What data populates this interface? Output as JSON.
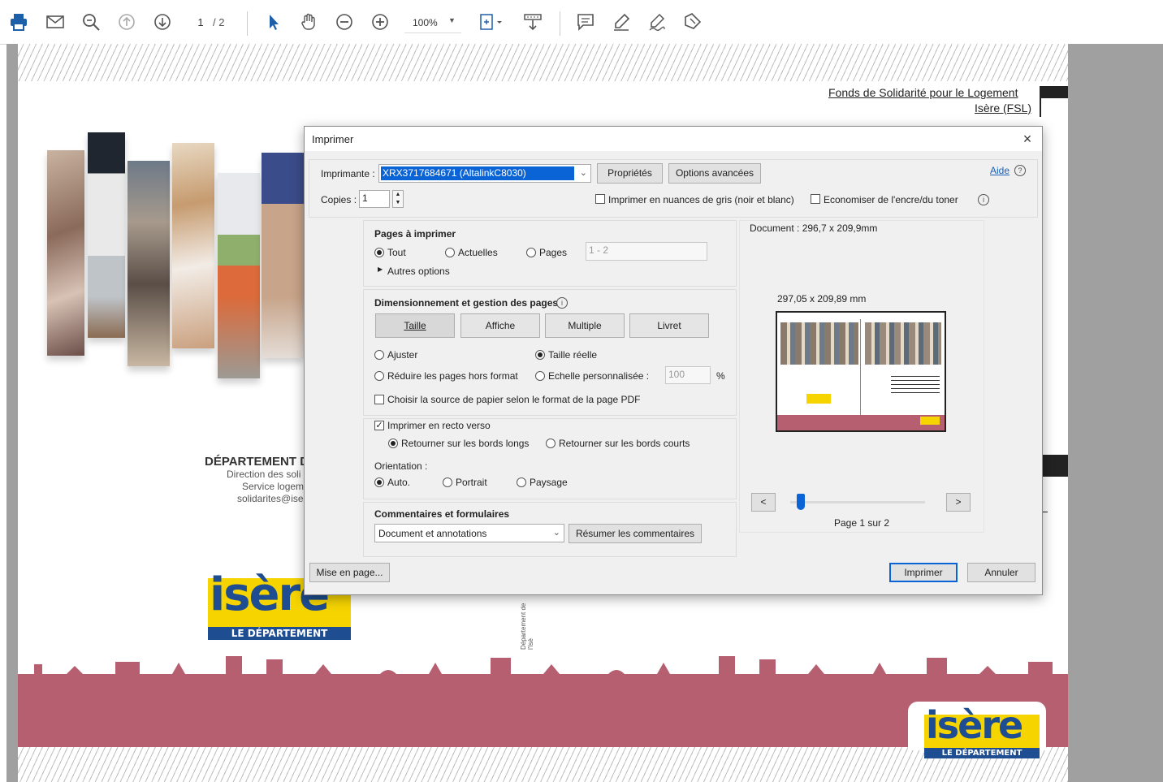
{
  "toolbar": {
    "page_current": "1",
    "page_total": "/ 2",
    "zoom": "100%",
    "icons": [
      "print-icon",
      "mail-icon",
      "zoom-search-icon",
      "prev-page-icon",
      "next-page-icon",
      "select-arrow-icon",
      "hand-icon",
      "zoom-out-icon",
      "zoom-in-icon",
      "fit-page-icon",
      "scroll-icon",
      "comment-icon",
      "highlight-icon",
      "sign-icon",
      "fill-sign-icon"
    ]
  },
  "document": {
    "header_line1": "Fonds de Solidarité pour le Logement",
    "header_line2": "Isère (FSL)",
    "dept_title": "DÉPARTEMENT D",
    "dept_line1": "Direction des soli",
    "dept_line2": "Service logem",
    "dept_line3": "solidarites@ise",
    "logo_word": "isère",
    "logo_sub": "LE DÉPARTEMENT",
    "vertical_text": "Département de l'Isè"
  },
  "dialog": {
    "title": "Imprimer",
    "close": "×",
    "printer_label": "Imprimante :",
    "printer_value": "XRX3717684671 (AltalinkC8030)",
    "properties_btn": "Propriétés",
    "advanced_btn": "Options avancées",
    "help_link": "Aide",
    "copies_label": "Copies :",
    "copies_value": "1",
    "grayscale_label": "Imprimer en nuances de gris (noir et blanc)",
    "save_ink_label": "Economiser de l'encre/du toner",
    "pages_section": {
      "title": "Pages à imprimer",
      "all": "Tout",
      "current": "Actuelles",
      "pages": "Pages",
      "range_placeholder": "1 - 2",
      "more": "Autres options"
    },
    "sizing_section": {
      "title": "Dimensionnement et gestion des pages",
      "tabs": [
        "Taille",
        "Affiche",
        "Multiple",
        "Livret"
      ],
      "fit": "Ajuster",
      "actual": "Taille réelle",
      "shrink": "Réduire les pages hors format",
      "custom": "Echelle personnalisée :",
      "custom_value": "100",
      "percent": "%",
      "paper_source": "Choisir la source de papier selon le format de la page PDF"
    },
    "duplex_section": {
      "duplex": "Imprimer en recto verso",
      "long_edge": "Retourner sur les bords longs",
      "short_edge": "Retourner sur les bords courts",
      "orientation": "Orientation :",
      "auto": "Auto.",
      "portrait": "Portrait",
      "landscape": "Paysage"
    },
    "comments_section": {
      "title": "Commentaires et formulaires",
      "select_value": "Document et annotations",
      "summarize_btn": "Résumer les commentaires"
    },
    "preview": {
      "doc_size": "Document : 296,7 x 209,9mm",
      "paper_size": "297,05 x 209,89 mm",
      "prev": "<",
      "next": ">",
      "page_info": "Page 1 sur 2",
      "slider_fraction": 0
    },
    "page_setup_btn": "Mise en page...",
    "print_btn": "Imprimer",
    "cancel_btn": "Annuler"
  }
}
